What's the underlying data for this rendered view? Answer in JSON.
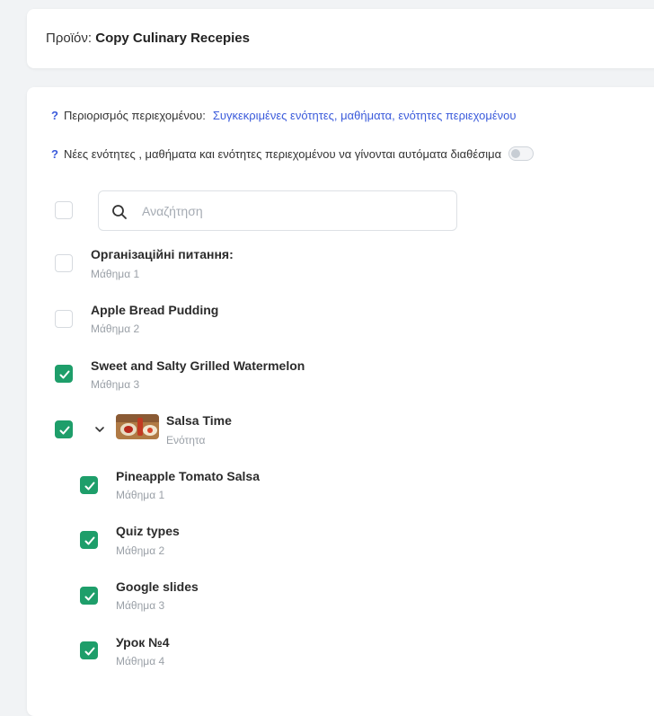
{
  "header": {
    "product_label": "Προϊόν:",
    "product_name": "Copy Culinary Recepies"
  },
  "settings": {
    "restriction_label": "Περιορισμός περιεχομένου:",
    "restriction_value": "Συγκεκριμένες ενότητες, μαθήματα, ενότητες περιεχομένου",
    "auto_available_label": "Νέες ενότητες , μαθήματα και ενότητες περιεχομένου να γίνονται αυτόματα διαθέσιμα",
    "auto_available_on": false,
    "help_glyph": "?"
  },
  "search": {
    "placeholder": "Αναζήτηση",
    "value": ""
  },
  "items": [
    {
      "title": "Організаційні питання:",
      "subtitle": "Μάθημα 1",
      "checked": false
    },
    {
      "title": "Apple Bread Pudding",
      "subtitle": "Μάθημα 2",
      "checked": false
    },
    {
      "title": "Sweet and Salty Grilled Watermelon",
      "subtitle": "Μάθημα 3",
      "checked": true
    },
    {
      "title": "Salsa Time",
      "subtitle": "Ενότητα",
      "checked": true,
      "expanded": true,
      "icon": "chevron-down-icon",
      "children": [
        {
          "title": "Pineapple Tomato Salsa",
          "subtitle": "Μάθημα 1",
          "checked": true
        },
        {
          "title": "Quiz types",
          "subtitle": "Μάθημα 2",
          "checked": true
        },
        {
          "title": "Google slides",
          "subtitle": "Μάθημα 3",
          "checked": true
        },
        {
          "title": "Урок №4",
          "subtitle": "Μάθημα 4",
          "checked": true
        }
      ]
    }
  ],
  "colors": {
    "accent": "#1e9e6a",
    "link": "#3b5bdb"
  }
}
